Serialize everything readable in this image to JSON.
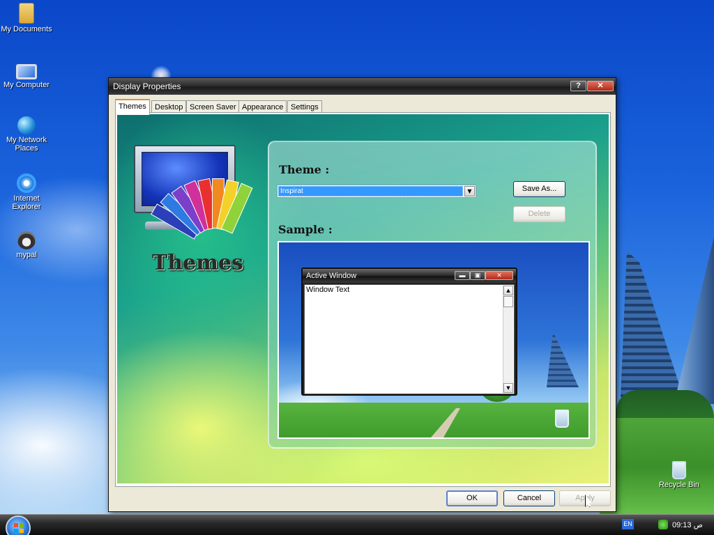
{
  "desktop": {
    "icons": [
      {
        "label": "My Documents",
        "icon": "folder-icon"
      },
      {
        "label": "My Computer",
        "icon": "computer-icon"
      },
      {
        "label": "My Network Places",
        "icon": "network-icon"
      },
      {
        "label": "Internet Explorer",
        "icon": "ie-icon"
      },
      {
        "label": "mypal",
        "icon": "mypal-icon"
      },
      {
        "label": "Recycle Bin",
        "icon": "recycle-bin-icon"
      }
    ]
  },
  "window": {
    "title": "Display Properties",
    "help_glyph": "?",
    "close_glyph": "✕",
    "tabs": [
      {
        "label": "Themes",
        "active": true
      },
      {
        "label": "Desktop"
      },
      {
        "label": "Screen Saver"
      },
      {
        "label": "Appearance"
      },
      {
        "label": "Settings"
      }
    ],
    "art_title": "Themes",
    "theme_label": "Theme :",
    "theme_selected": "Inspirat",
    "select_arrow": "▼",
    "save_as_label": "Save As...",
    "delete_label": "Delete",
    "sample_label": "Sample :",
    "sample": {
      "window_title": "Active Window",
      "window_text": "Window Text",
      "min_glyph": "▬",
      "max_glyph": "▣",
      "close_glyph": "✕",
      "scroll_up": "▲",
      "scroll_down": "▼"
    },
    "ok_label": "OK",
    "cancel_label": "Cancel",
    "apply_label": "Apply"
  },
  "taskbar": {
    "language": "EN",
    "clock": "09:13 ص"
  },
  "colors": {
    "selection": "#3399ff",
    "tab_accent": "#e68b2c",
    "close_button": "#b02a18"
  }
}
